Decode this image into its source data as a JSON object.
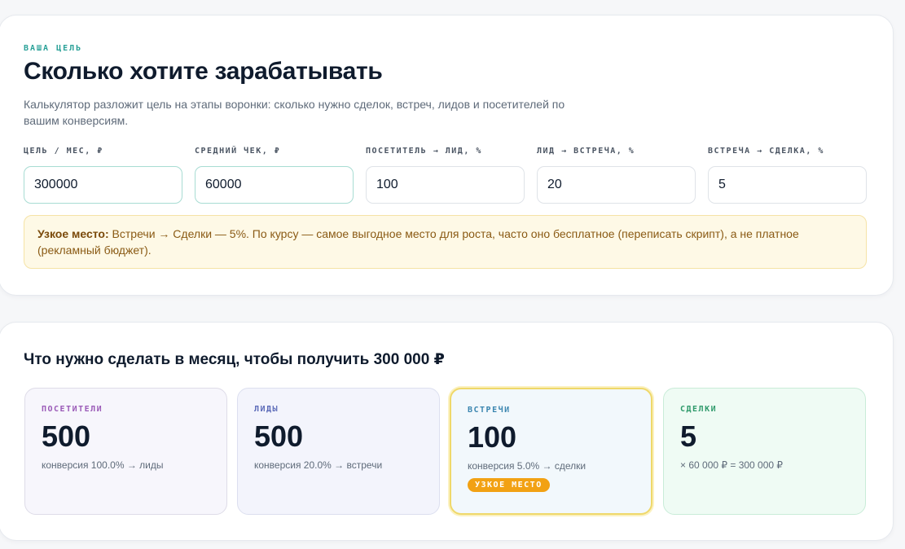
{
  "goal": {
    "eyebrow": "ВАША ЦЕЛЬ",
    "title": "Сколько хотите зарабатывать",
    "description": "Калькулятор разложит цель на этапы воронки: сколько нужно сделок, встреч, лидов и посетителей по вашим конверсиям.",
    "fields": [
      {
        "label": "ЦЕЛЬ / МЕС, ₽",
        "value": "300000"
      },
      {
        "label": "СРЕДНИЙ ЧЕК, ₽",
        "value": "60000"
      },
      {
        "label": "ПОСЕТИТЕЛЬ → ЛИД, %",
        "value": "100"
      },
      {
        "label": "ЛИД → ВСТРЕЧА, %",
        "value": "20"
      },
      {
        "label": "ВСТРЕЧА → СДЕЛКА, %",
        "value": "5"
      }
    ],
    "bottleneck": {
      "bold": "Узкое место:",
      "text": " Встречи → Сделки — 5%. По курсу — самое выгодное место для роста, часто оно бесплатное (переписать скрипт), а не платное (рекламный бюджет)."
    }
  },
  "plan": {
    "title": "Что нужно сделать в месяц, чтобы получить 300 000 ₽",
    "stages": [
      {
        "label": "ПОСЕТИТЕЛИ",
        "value": "500",
        "note": "конверсия 100.0% → лиды"
      },
      {
        "label": "ЛИДЫ",
        "value": "500",
        "note": "конверсия 20.0% → встречи"
      },
      {
        "label": "ВСТРЕЧИ",
        "value": "100",
        "note": "конверсия 5.0% → сделки",
        "badge": "УЗКОЕ МЕСТО"
      },
      {
        "label": "СДЕЛКИ",
        "value": "5",
        "note": "× 60 000 ₽ = 300 000 ₽"
      }
    ]
  },
  "colors": {
    "accent_teal": "#2aa198",
    "badge_orange": "#f2a113",
    "bottleneck_bg": "#fef9e6"
  }
}
